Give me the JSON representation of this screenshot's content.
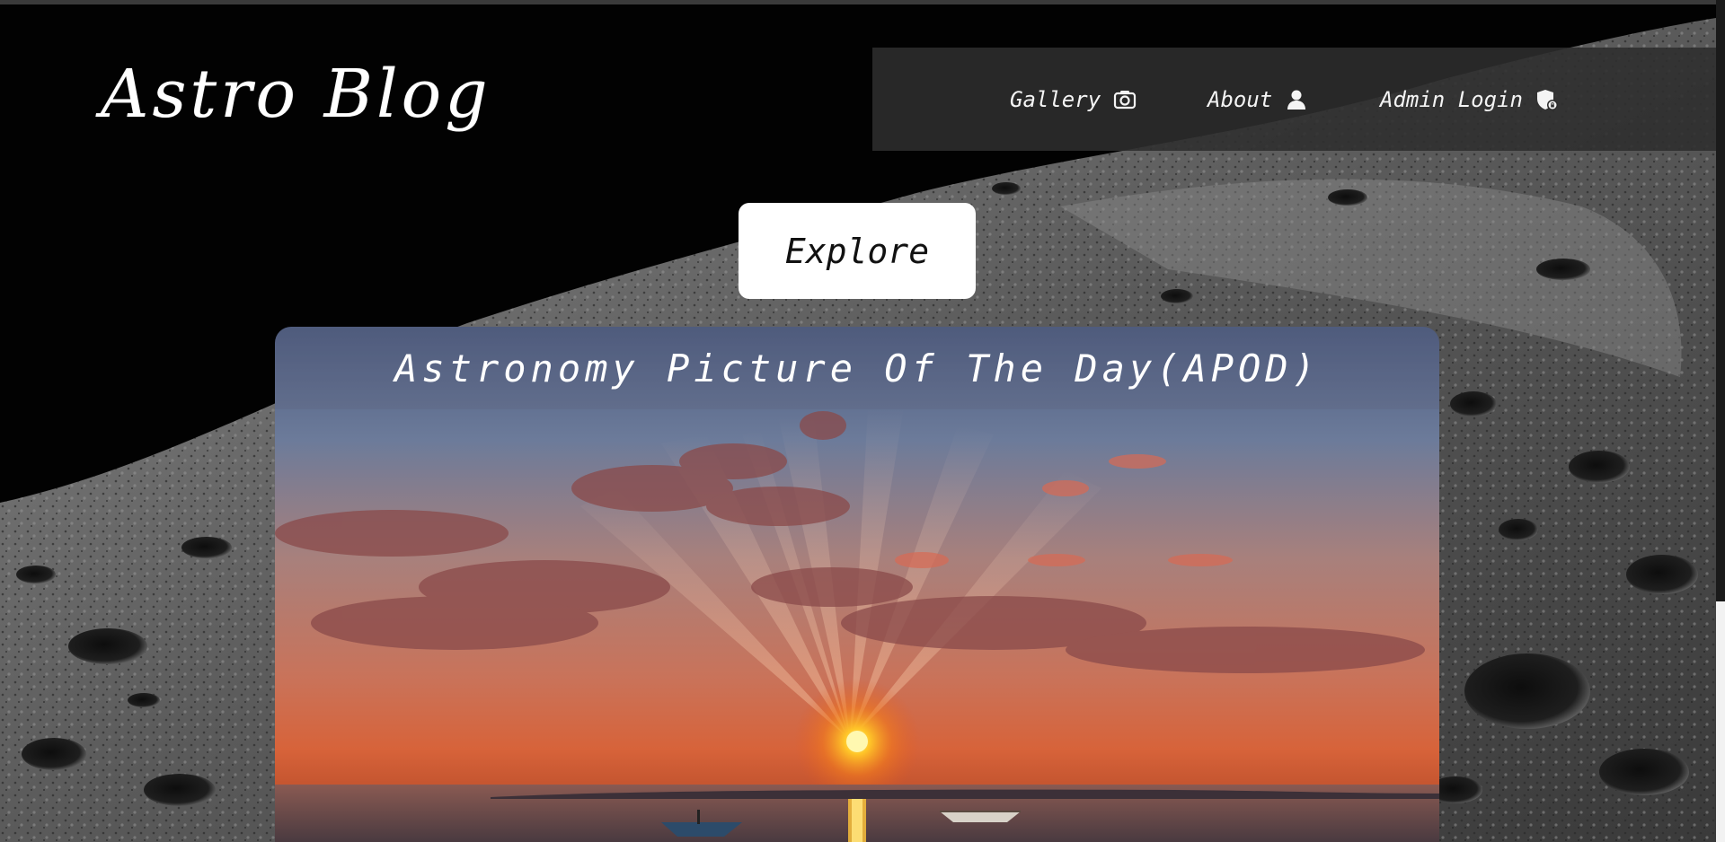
{
  "header": {
    "brand": "Astro Blog"
  },
  "nav": {
    "items": [
      {
        "label": "Gallery",
        "icon": "camera-icon"
      },
      {
        "label": "About",
        "icon": "user-icon"
      },
      {
        "label": "Admin Login",
        "icon": "shield-lock-icon"
      }
    ]
  },
  "explore": {
    "label": "Explore"
  },
  "apod": {
    "title": "Astronomy Picture Of The Day(APOD)"
  },
  "colors": {
    "background": "#030303",
    "nav_background": "#2d2d2d",
    "text": "#ffffff",
    "button": "#ffffff"
  }
}
